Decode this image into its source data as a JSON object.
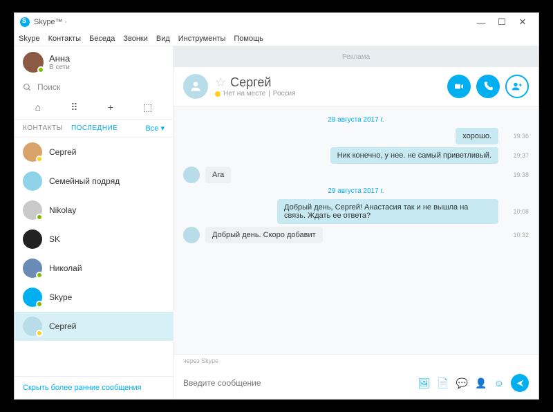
{
  "titlebar": {
    "title": "Skype™"
  },
  "menu": {
    "items": [
      "Skype",
      "Контакты",
      "Беседа",
      "Звонки",
      "Вид",
      "Инструменты",
      "Помощь"
    ]
  },
  "profile": {
    "name": "Анна",
    "status": "В сети"
  },
  "search": {
    "placeholder": "Поиск"
  },
  "sidebar_tabs": {
    "contacts": "КОНТАКТЫ",
    "recent": "ПОСЛЕДНИЕ",
    "filter": "Все ▾"
  },
  "contacts": [
    {
      "name": "Сергей",
      "color": "#d9a36a",
      "status": "away"
    },
    {
      "name": "Семейный подряд",
      "color": "#8fd3e8",
      "status": ""
    },
    {
      "name": "Nikolay",
      "color": "#c9c9c9",
      "status": "online"
    },
    {
      "name": "SK",
      "color": "#222",
      "status": ""
    },
    {
      "name": "Николай",
      "color": "#6a8bb5",
      "status": "online"
    },
    {
      "name": "Skype",
      "color": "#00aff0",
      "status": "online"
    },
    {
      "name": "Сергей",
      "color": "#b8dde8",
      "status": "away"
    }
  ],
  "sidebar_footer": "Скрыть более ранние сообщения",
  "ad": "Реклама",
  "chat_header": {
    "name": "Сергей",
    "status_text": "Нет на месте",
    "location": "Россия"
  },
  "conversation": {
    "date1": "28 августа 2017 г.",
    "date2": "29 августа 2017 г.",
    "msgs": [
      {
        "text": "хорошо.",
        "mine": true,
        "time": "19:36"
      },
      {
        "text": "Ник конечно, у нее. не самый приветливый.",
        "mine": true,
        "time": "19:37"
      },
      {
        "text": "Ага",
        "mine": false,
        "time": "19:38"
      },
      {
        "text": "Добрый день, Сергей! Анастасия так и не вышла на связь. Ждать ее ответа?",
        "mine": true,
        "time": "10:08"
      },
      {
        "text": "Добрый день. Скоро добавит",
        "mine": false,
        "time": "10:32"
      }
    ]
  },
  "via": "через Skype",
  "composer": {
    "placeholder": "Введите сообщение"
  }
}
